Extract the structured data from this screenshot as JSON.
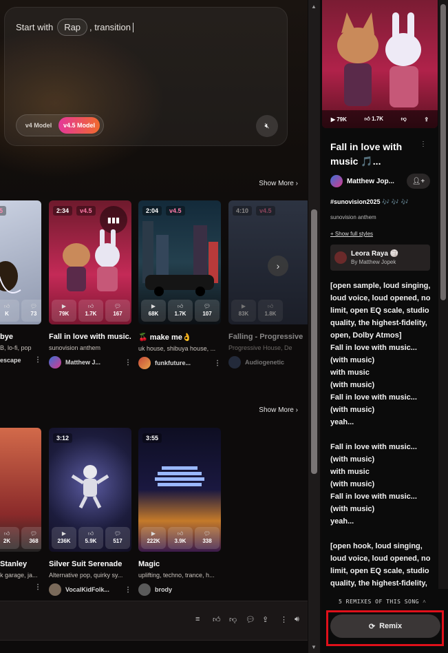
{
  "composer": {
    "prompt_prefix": "Start with",
    "style_chip": "Rap",
    "prompt_suffix": ", transition",
    "model_v4": "v4 Model",
    "model_v45": "v4.5 Model"
  },
  "sections": {
    "show_more": "Show More",
    "show_more_icon": "chevron-right-icon"
  },
  "row1": [
    {
      "title": "bye",
      "subtitle": "B, lo-fi, pop",
      "author": "escape",
      "badge_duration": "",
      "badge_version": "5",
      "plays": "",
      "likes": "K",
      "comments": "73"
    },
    {
      "title": "Fall in love with music...",
      "subtitle": "sunovision anthem",
      "author": "Matthew J...",
      "badge_duration": "2:34",
      "badge_version": "v4.5",
      "plays": "79K",
      "likes": "1.7K",
      "comments": "167"
    },
    {
      "title": "🍒 make me👌",
      "subtitle": "uk house, shibuya house, ...",
      "author": "funkfuture...",
      "badge_duration": "2:04",
      "badge_version": "v4.5",
      "plays": "68K",
      "likes": "1.7K",
      "comments": "107"
    },
    {
      "title": "Falling - Progressive",
      "subtitle": "Progressive House, De",
      "author": "Audiogenetic",
      "badge_duration": "4:10",
      "badge_version": "v4.5",
      "plays": "83K",
      "likes": "1.8K",
      "comments": ""
    }
  ],
  "row2": [
    {
      "title": "Stanley",
      "subtitle": "k garage, ja...",
      "author": "",
      "badge_duration": "",
      "plays": "",
      "likes": "2K",
      "comments": "368"
    },
    {
      "title": "Silver Suit Serenade",
      "subtitle": "Alternative pop, quirky sy...",
      "author": "VocalKidFolk...",
      "badge_duration": "3:12",
      "plays": "236K",
      "likes": "5.9K",
      "comments": "517"
    },
    {
      "title": "Magic",
      "subtitle": "uplifting, techno, trance, h...",
      "author": "brody",
      "badge_duration": "3:55",
      "plays": "222K",
      "likes": "3.9K",
      "comments": "338"
    }
  ],
  "side": {
    "cover_plays": "79K",
    "cover_likes": "1.7K",
    "title": "Fall in love with music 🎵...",
    "author": "Matthew Jop...",
    "tags": "#sunovision2025 🎶 🎶 🎶",
    "subtitle": "sunovision anthem",
    "show_styles": "+ Show full styles",
    "remix_of_name": "Leora Raya 🏐",
    "remix_of_by": "By Matthew Jopek",
    "lyrics": "[open sample, loud singing, loud voice, loud opened, no limit, open EQ scale, studio quality, the highest-fidelity, open, Dolby Atmos]\nFall in love with music...\n(with music)\nwith music\n(with music)\nFall in love with music...\n(with music)\nyeah...\n\nFall in love with music...\n(with music)\nwith music\n(with music)\nFall in love with music...\n(with music)\nyeah...\n\n[open hook, loud singing, loud voice, loud opened, no limit, open EQ scale, studio quality, the highest-fidelity,",
    "remix_count": "5 REMIXES OF THIS SONG",
    "remix_label": "Remix"
  },
  "colors": {
    "accent_pink": "#e4389a",
    "accent_orange": "#f06a2c",
    "highlight_red": "#e0101a"
  }
}
